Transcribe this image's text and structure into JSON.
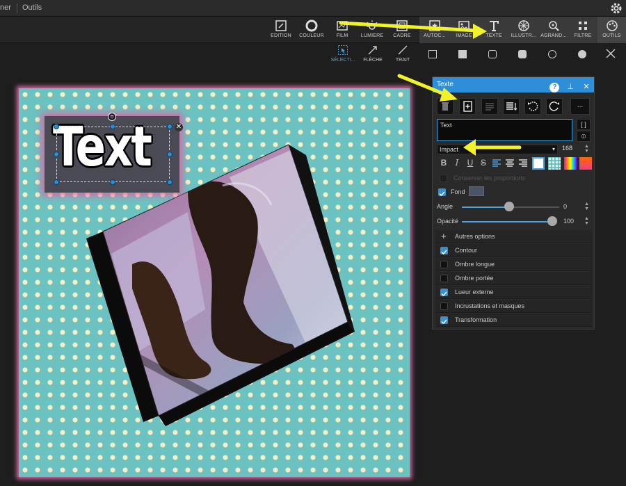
{
  "menubar": {
    "item1": "ner",
    "item2": "Outils"
  },
  "toolbar": {
    "items": [
      {
        "label": "EDITION",
        "icon": "edit-icon"
      },
      {
        "label": "COULEUR",
        "icon": "color-icon"
      },
      {
        "label": "FILM",
        "icon": "film-icon"
      },
      {
        "label": "LUMIÈRE",
        "icon": "light-icon"
      },
      {
        "label": "CADRE",
        "icon": "frame-icon"
      },
      {
        "label": "AUTOC...",
        "icon": "sticker-icon"
      },
      {
        "label": "IMAGE",
        "icon": "image-icon"
      },
      {
        "label": "TEXTE",
        "icon": "text-icon"
      },
      {
        "label": "ILLUSTR...",
        "icon": "illustration-icon"
      },
      {
        "label": "AGRAND...",
        "icon": "zoom-icon"
      },
      {
        "label": "FILTRE",
        "icon": "filter-icon"
      },
      {
        "label": "OUTILS",
        "icon": "tools-icon"
      }
    ]
  },
  "toolbar2": {
    "items": [
      {
        "label": "SÉLECTI...",
        "icon": "select-icon"
      },
      {
        "label": "FLÈCHE",
        "icon": "arrow-icon"
      },
      {
        "label": "TRAIT",
        "icon": "line-icon"
      }
    ]
  },
  "canvas": {
    "text": "Text"
  },
  "panel": {
    "title": "Texte",
    "text_value": "Text",
    "side_btn1": "[ ]",
    "side_btn2": "⦶",
    "font": "Impact",
    "font_size": "168",
    "proportions_label": "Conserver les proportions",
    "fond_label": "Fond",
    "angle_label": "Angle",
    "angle_value": "0",
    "opacity_label": "Opacité",
    "opacity_value": "100",
    "options": [
      {
        "label": "Autres options",
        "type": "plus"
      },
      {
        "label": "Contour",
        "checked": true
      },
      {
        "label": "Ombre longue",
        "checked": false
      },
      {
        "label": "Ombre portée",
        "checked": false
      },
      {
        "label": "Lueur externe",
        "checked": true
      },
      {
        "label": "Incrustations et masques",
        "checked": false
      },
      {
        "label": "Transformation",
        "checked": true
      }
    ],
    "more_btn": "..."
  },
  "colors": {
    "accent": "#2e8fd8",
    "canvas_bg": "#6cc2c1",
    "dot": "#f6efc4",
    "arrow": "#f2f22a"
  }
}
